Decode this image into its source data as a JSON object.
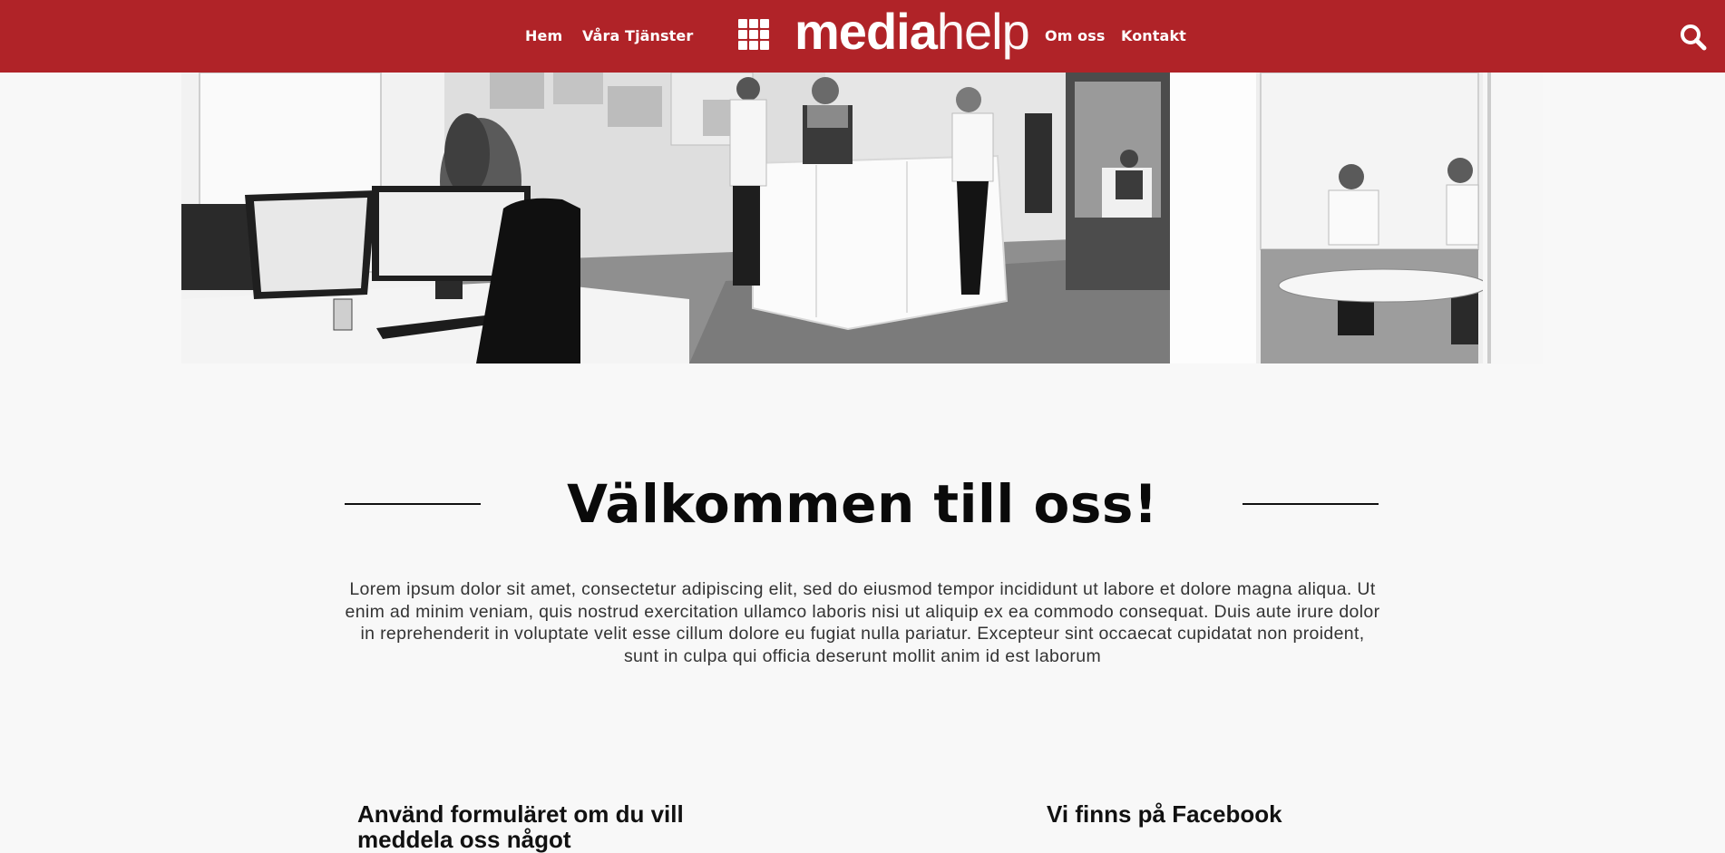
{
  "header": {
    "nav_left": [
      {
        "label": "Hem"
      },
      {
        "label": "Våra Tjänster"
      }
    ],
    "nav_right": [
      {
        "label": "Om oss"
      },
      {
        "label": "Kontakt"
      }
    ],
    "logo": {
      "part1": "media",
      "part2": "help"
    },
    "menu_icon": "grid-menu-icon",
    "search_icon": "search-icon",
    "background_color": "#b02328"
  },
  "hero": {
    "style": "black-and-white office photo"
  },
  "welcome": {
    "title": "Välkommen till oss!",
    "body": "Lorem ipsum dolor sit amet, consectetur adipiscing elit, sed do eiusmod tempor incididunt ut labore et dolore magna aliqua. Ut enim ad minim veniam, quis nostrud exercitation ullamco laboris nisi ut aliquip ex ea commodo consequat. Duis aute irure dolor in reprehenderit in voluptate velit esse cillum dolore eu fugiat nulla pariatur. Excepteur sint occaecat cupidatat non proident, sunt in culpa qui officia deserunt mollit anim id est laborum"
  },
  "sections": {
    "form_heading": "Använd formuläret om du vill meddela oss något",
    "facebook_heading": "Vi finns på Facebook"
  }
}
